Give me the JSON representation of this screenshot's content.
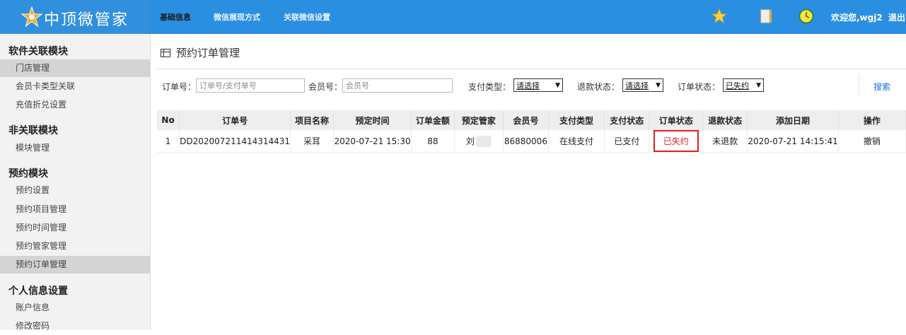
{
  "app": {
    "logo_text": "中顶微管家"
  },
  "header": {
    "tabs": [
      {
        "label": "基础信息"
      },
      {
        "label": "微信展现方式"
      },
      {
        "label": "关联微信设置"
      }
    ],
    "welcome": "欢迎您,wgj2",
    "logout": "退出"
  },
  "sidebar": {
    "sections": [
      {
        "title": "软件关联模块",
        "items": [
          "门店管理",
          "会员卡类型关联",
          "充值折兑设置"
        ]
      },
      {
        "title": "非关联模块",
        "items": [
          "模块管理"
        ]
      },
      {
        "title": "预约模块",
        "items": [
          "预约设置",
          "预约项目管理",
          "预约时间管理",
          "预约管家管理",
          "预约订单管理"
        ]
      },
      {
        "title": "个人信息设置",
        "items": [
          "账户信息",
          "修改密码"
        ]
      }
    ]
  },
  "page": {
    "title": "预约订单管理"
  },
  "filters": {
    "order_label": "订单号：",
    "order_placeholder": "订单号/支付单号",
    "member_label": "会员号：",
    "member_placeholder": "会员号",
    "pay_type_label": "支付类型：",
    "pay_type_value": "请选择",
    "refund_label": "退款状态：",
    "refund_value": "请选择",
    "order_status_label": "订单状态：",
    "order_status_value": "已失约",
    "search": "搜索"
  },
  "table": {
    "headers": [
      "No",
      "订单号",
      "项目名称",
      "预定时间",
      "订单金额",
      "预定管家",
      "会员号",
      "支付类型",
      "支付状态",
      "订单状态",
      "退款状态",
      "添加日期",
      "操作"
    ],
    "rows": [
      {
        "no": "1",
        "order_id": "DD202007211414314431",
        "project": "采耳",
        "book_time": "2020-07-21 15:30",
        "amount": "88",
        "steward": "刘",
        "member": "86880006",
        "pay_type": "在线支付",
        "pay_status": "已支付",
        "order_status": "已失约",
        "refund_status": "未退款",
        "added": "2020-07-21 14:15:41",
        "action": "撤销"
      }
    ]
  },
  "colors": {
    "header_bg": "#2a8fe0",
    "accent_red": "#e02020",
    "accent_green": "#1c8a1c",
    "link_blue": "#1e6fd6"
  }
}
